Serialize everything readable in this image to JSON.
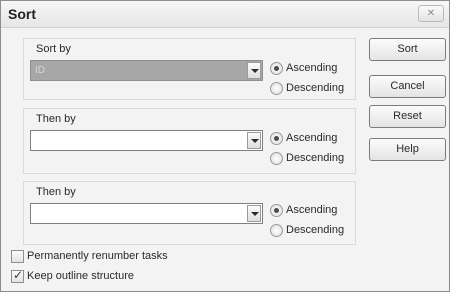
{
  "dialog": {
    "title": "Sort",
    "close_icon": "close-icon",
    "close_glyph": "✕"
  },
  "groups": [
    {
      "label": "Sort by",
      "combo_value": "ID",
      "combo_disabled": true,
      "ascending_label": "Ascending",
      "descending_label": "Descending",
      "selected": "ascending"
    },
    {
      "label": "Then by",
      "combo_value": "",
      "combo_disabled": false,
      "ascending_label": "Ascending",
      "descending_label": "Descending",
      "selected": "ascending"
    },
    {
      "label": "Then by",
      "combo_value": "",
      "combo_disabled": false,
      "ascending_label": "Ascending",
      "descending_label": "Descending",
      "selected": "ascending"
    }
  ],
  "buttons": {
    "sort": "Sort",
    "cancel": "Cancel",
    "reset": "Reset",
    "help": "Help"
  },
  "options": {
    "renumber_label": "Permanently renumber tasks",
    "renumber_checked": false,
    "outline_label": "Keep outline structure",
    "outline_checked": true
  },
  "icons": {
    "dropdown": "chevron-down-icon",
    "check_glyph": "✓"
  }
}
